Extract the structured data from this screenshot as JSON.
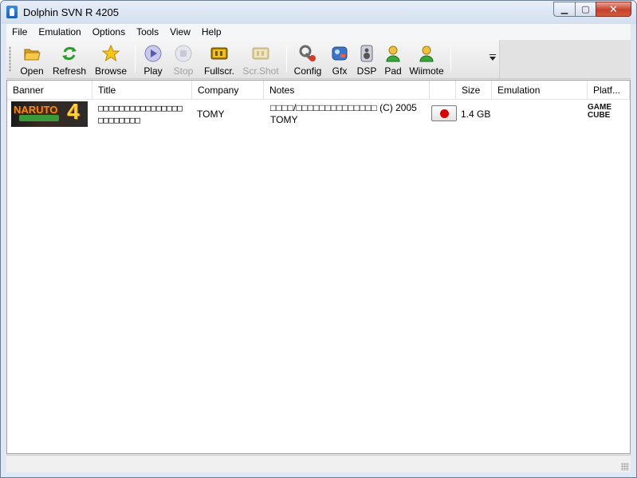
{
  "window": {
    "title": "Dolphin SVN R 4205"
  },
  "menu": [
    "File",
    "Emulation",
    "Options",
    "Tools",
    "View",
    "Help"
  ],
  "toolbar": {
    "buttons": [
      {
        "label": "Open",
        "icon": "folder-icon",
        "enabled": true
      },
      {
        "label": "Refresh",
        "icon": "refresh-icon",
        "enabled": true
      },
      {
        "label": "Browse",
        "icon": "star-icon",
        "enabled": true
      },
      {
        "label": "Play",
        "icon": "play-icon",
        "enabled": true
      },
      {
        "label": "Stop",
        "icon": "stop-icon",
        "enabled": false
      },
      {
        "label": "Fullscr.",
        "icon": "fullscreen-icon",
        "enabled": true
      },
      {
        "label": "Scr.Shot",
        "icon": "screenshot-icon",
        "enabled": false
      },
      {
        "label": "Config",
        "icon": "wrench-icon",
        "enabled": true
      },
      {
        "label": "Gfx",
        "icon": "graphics-icon",
        "enabled": true
      },
      {
        "label": "DSP",
        "icon": "speaker-icon",
        "enabled": true
      },
      {
        "label": "Pad",
        "icon": "pad-user-icon",
        "enabled": true
      },
      {
        "label": "Wiimote",
        "icon": "wiimote-user-icon",
        "enabled": true
      }
    ]
  },
  "list": {
    "columns": [
      "Banner",
      "Title",
      "Company",
      "Notes",
      "",
      "Size",
      "Emulation",
      "Platf..."
    ],
    "rows": [
      {
        "banner_text": "NARUTO",
        "banner_number": "4",
        "title": "□□□□□□□□□□□□□□□□\n□□□□□□□□",
        "company": "TOMY",
        "notes": "□□□□/□□□□□□□□□□□□□□ (C) 2005\nTOMY",
        "region": "japan-flag-icon",
        "size": "1.4 GB",
        "emulation": "",
        "platform": "GAME\nCUBE"
      }
    ]
  },
  "colors": {
    "accent_red": "#d40000",
    "close_button": "#c7402c"
  }
}
